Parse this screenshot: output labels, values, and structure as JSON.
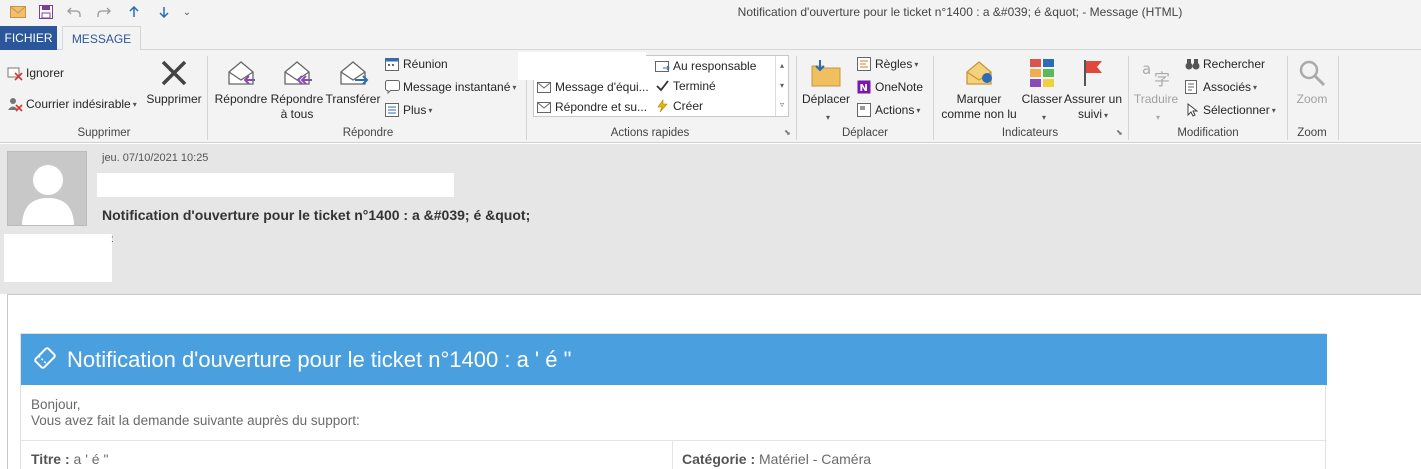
{
  "window": {
    "title": "Notification d'ouverture pour le ticket n°1400 : a &#039; é &quot; - Message (HTML)"
  },
  "quick_access": {
    "qa_more": "⌄"
  },
  "tabs": [
    {
      "label": "FICHIER"
    },
    {
      "label": "MESSAGE"
    }
  ],
  "ribbon": {
    "groups": {
      "supprimer": "Supprimer",
      "repondre": "Répondre",
      "actions_rapides": "Actions rapides",
      "deplacer": "Déplacer",
      "indicateurs": "Indicateurs",
      "modification": "Modification",
      "zoom": "Zoom"
    },
    "supprimer": {
      "ignorer": "Ignorer",
      "courrier": "Courrier indésirable",
      "supprimer": "Supprimer"
    },
    "repondre": {
      "repondre": "Répondre",
      "repondre_tous_1": "Répondre",
      "repondre_tous_2": "à tous",
      "transferer": "Transférer",
      "reunion": "Réunion",
      "message_instantane": "Message instantané",
      "plus": "Plus"
    },
    "actions_rapides": {
      "message_equipe": "Message d'équi...",
      "repondre_suppr": "Répondre et su...",
      "au_responsable": "Au responsable",
      "termine": "Terminé",
      "creer": "Créer"
    },
    "deplacer": {
      "deplacer": "Déplacer",
      "regles": "Règles",
      "onenote": "OneNote",
      "actions": "Actions"
    },
    "indicateurs": {
      "marquer_1": "Marquer",
      "marquer_2": "comme non lu",
      "classer": "Classer",
      "assurer_1": "Assurer un",
      "assurer_2": "suivi"
    },
    "modification": {
      "traduire": "Traduire",
      "rechercher": "Rechercher",
      "associes": "Associés",
      "selectionner": "Sélectionner"
    },
    "zoom": {
      "zoom": "Zoom"
    }
  },
  "message": {
    "date": "jeu. 07/10/2021 10:25",
    "subject": "Notification d'ouverture pour le ticket n°1400 : a &#039; é &quot;",
    "to_colon": ":"
  },
  "body": {
    "card_title": "Notification d'ouverture pour le ticket n°1400 : a ' é \"",
    "greeting_1": "Bonjour,",
    "greeting_2": "Vous avez fait la demande suivante auprès du support:",
    "titre_label": "Titre :",
    "titre_value": "a ' é \"",
    "categorie_label": "Catégorie :",
    "categorie_value": "Matériel - Caméra"
  },
  "colors": {
    "file_tab": "#2b579a",
    "card_header": "#4a9fde",
    "ribbon_bg": "#f3f3f3",
    "header_bg": "#e6e6e6"
  }
}
